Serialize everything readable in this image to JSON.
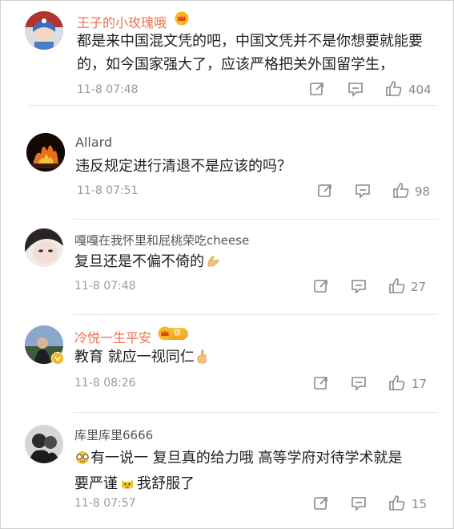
{
  "comments": [
    {
      "username": "王子的小玫瑰哦",
      "text": "都是来中国混文凭的吧，中国文凭并不是你想要就能要的，如今国家强大了，应该严格把关外国留学生，",
      "time": "11-8 07:48",
      "likes": "404",
      "name_color": "#eb7350"
    },
    {
      "username": "Allard",
      "text": "违反规定进行清退不是应该的吗？",
      "time": "11-8 07:51",
      "likes": "98",
      "name_color": "#555555"
    },
    {
      "username": "嘎嘎在我怀里和屁桃荣吃cheese",
      "text": "复旦还是不偏不倚的",
      "time": "11-8 07:48",
      "likes": "27",
      "name_color": "#555555"
    },
    {
      "username": "冷悦一生平安",
      "badge": "铁粉",
      "text": "教育 就应一视同仁",
      "time": "11-8 08:26",
      "likes": "17",
      "name_color": "#eb7350"
    },
    {
      "username": "库里库里6666",
      "text_parts": [
        "有一说一 复旦真的给力哦 高等学府对待学术就是",
        "要严谨",
        "我舒服了"
      ],
      "time": "11-8 07:57",
      "likes": "15",
      "name_color": "#555555"
    }
  ],
  "icons": {
    "repost": "repost-icon",
    "comment": "comment-icon",
    "like": "thumbs-up-icon",
    "vip_crown": "crown-icon",
    "verified": "verified-badge-icon"
  }
}
